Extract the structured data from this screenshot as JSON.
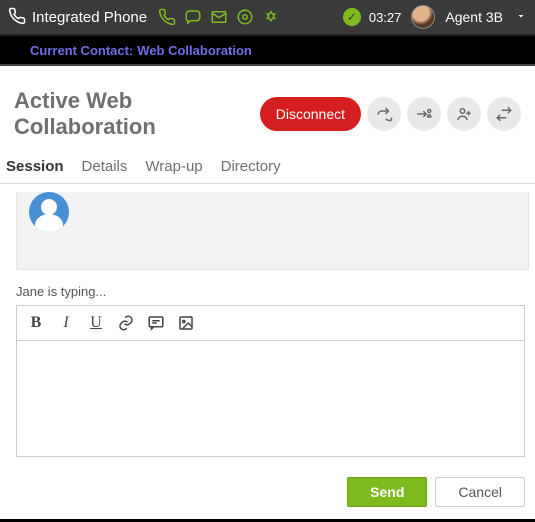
{
  "topbar": {
    "title": "Integrated Phone",
    "time": "03:27",
    "agent_name": "Agent 3B"
  },
  "contact_banner": {
    "label": "Current Contact:",
    "value": "Web Collaboration"
  },
  "heading": "Active Web Collaboration",
  "disconnect_label": "Disconnect",
  "tabs": [
    {
      "label": "Session",
      "active": true
    },
    {
      "label": "Details",
      "active": false
    },
    {
      "label": "Wrap-up",
      "active": false
    },
    {
      "label": "Directory",
      "active": false
    }
  ],
  "typing_indicator": "Jane is typing...",
  "toolbar_buttons": {
    "bold": "B",
    "italic": "I",
    "underline": "U"
  },
  "editor_value": "",
  "footer": {
    "send": "Send",
    "cancel": "Cancel"
  },
  "colors": {
    "accent_green": "#7fbb1f",
    "danger_red": "#d51e1e",
    "link_purple": "#6f6fe8"
  }
}
